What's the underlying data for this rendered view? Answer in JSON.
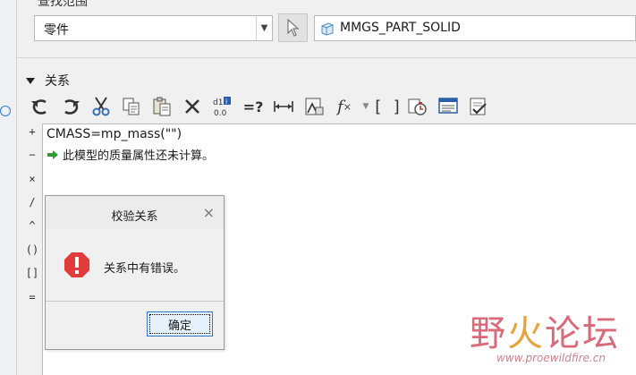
{
  "header": {
    "partial_title": "查找范围"
  },
  "filter": {
    "value": "零件",
    "dropdown_arrow": "▼"
  },
  "selection": {
    "value": "MMGS_PART_SOLID",
    "icon": "cube-icon"
  },
  "relations_section": {
    "title": "关系"
  },
  "operators": [
    "+",
    "−",
    "×",
    "/",
    "^",
    "()",
    "[]",
    "="
  ],
  "editor": {
    "line1": "CMASS=mp_mass(\"\")",
    "line2": "此模型的质量属性还未计算。"
  },
  "dialog": {
    "title": "校验关系",
    "message": "关系中有错误。",
    "ok_label": "确定",
    "close_glyph": "×"
  },
  "watermark": {
    "text": "野火论坛",
    "url": "www.proewildfire.cn"
  },
  "colors": {
    "accent": "#2a78d4",
    "error": "#e23b3b",
    "arrow_green": "#2e9a2e"
  }
}
